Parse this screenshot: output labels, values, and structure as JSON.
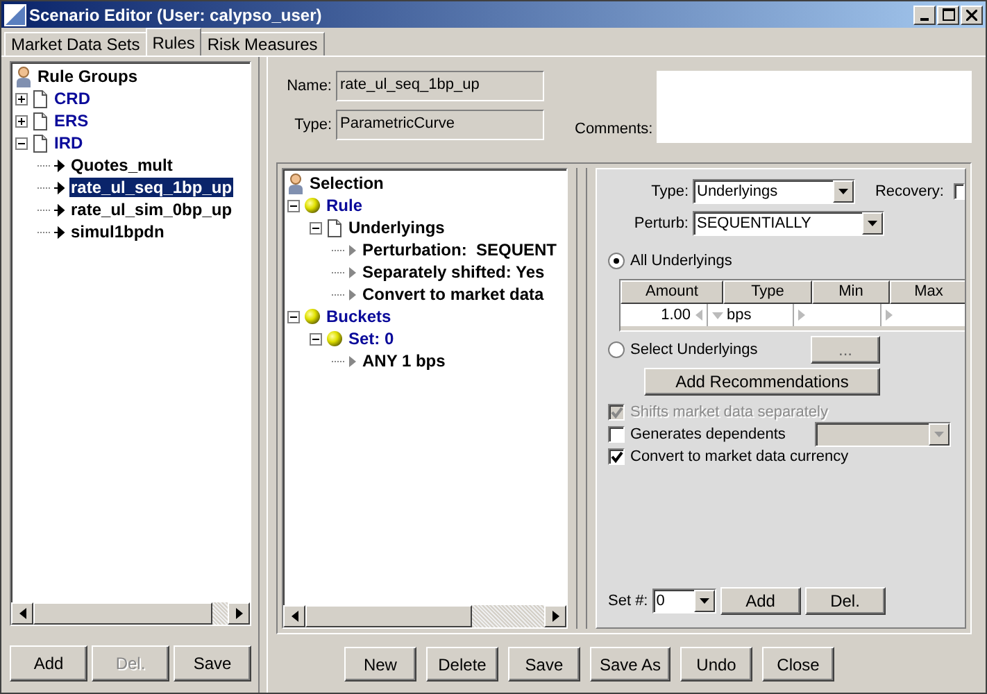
{
  "window": {
    "title": "Scenario Editor (User: calypso_user)"
  },
  "tabs": [
    {
      "label": "Market Data Sets",
      "selected": false
    },
    {
      "label": "Rules",
      "selected": true
    },
    {
      "label": "Risk Measures",
      "selected": false
    }
  ],
  "rule_groups": {
    "title": "Rule Groups",
    "items": [
      {
        "label": "CRD",
        "kind": "category",
        "expanded": false
      },
      {
        "label": "ERS",
        "kind": "category",
        "expanded": false
      },
      {
        "label": "IRD",
        "kind": "category",
        "expanded": true,
        "children": [
          {
            "label": "Quotes_mult",
            "kind": "item",
            "selected": false
          },
          {
            "label": "rate_ul_seq_1bp_up",
            "kind": "item",
            "selected": true
          },
          {
            "label": "rate_ul_sim_0bp_up",
            "kind": "item",
            "selected": false
          },
          {
            "label": "simul1bpdn",
            "kind": "item",
            "selected": false
          }
        ]
      }
    ]
  },
  "left_buttons": [
    {
      "label": "Add",
      "disabled": false
    },
    {
      "label": "Del.",
      "disabled": true
    },
    {
      "label": "Save",
      "disabled": false
    }
  ],
  "name": {
    "label": "Name:",
    "value": "rate_ul_seq_1bp_up"
  },
  "type": {
    "label": "Type:",
    "value": "ParametricCurve"
  },
  "comments": {
    "label": "Comments:"
  },
  "selection_tree": {
    "title": "Selection",
    "items": [
      {
        "label": "Rule",
        "kind": "ball",
        "expanded": true,
        "children": [
          {
            "label": "Underlyings",
            "kind": "doc",
            "expanded": true,
            "children": [
              {
                "label": "Perturbation:  SEQUENT",
                "kind": "detail"
              },
              {
                "label": "Separately shifted: Yes",
                "kind": "detail"
              },
              {
                "label": "Convert to market data",
                "kind": "detail"
              }
            ]
          }
        ]
      },
      {
        "label": "Buckets",
        "kind": "ball",
        "expanded": true,
        "children": [
          {
            "label": "Set: 0",
            "kind": "ball",
            "expanded": true,
            "children": [
              {
                "label": "ANY 1 bps",
                "kind": "detail"
              }
            ]
          }
        ]
      }
    ]
  },
  "detail": {
    "type_label": "Type:",
    "type_value": "Underlyings",
    "recovery_label": "Recovery:",
    "recovery_checked": false,
    "perturb_label": "Perturb:",
    "perturb_value": "SEQUENTIALLY",
    "options": [
      {
        "label": "All Underlyings",
        "selected": true
      },
      {
        "label": "Select Underlyings",
        "selected": false
      }
    ],
    "browse_button": "...",
    "table": {
      "columns": [
        "Amount",
        "Type",
        "Min",
        "Max"
      ],
      "rows": [
        {
          "amount": "1.00",
          "type": "bps"
        }
      ]
    },
    "recommend_button": "Add Recommendations",
    "checkboxes": [
      {
        "label": "Shifts market data separately",
        "checked": true,
        "disabled": true,
        "kind": "plain"
      },
      {
        "label": "Generates dependents",
        "checked": false,
        "disabled": false,
        "kind": "with-dropdown"
      },
      {
        "label": "Convert to market data currency",
        "checked": true,
        "disabled": false,
        "kind": "plain"
      }
    ],
    "set_label": "Set #:",
    "set_value": "0",
    "set_buttons": [
      "Add",
      "Del."
    ]
  },
  "bottom_buttons": [
    "New",
    "Delete",
    "Save",
    "Save As",
    "Undo",
    "Close"
  ]
}
